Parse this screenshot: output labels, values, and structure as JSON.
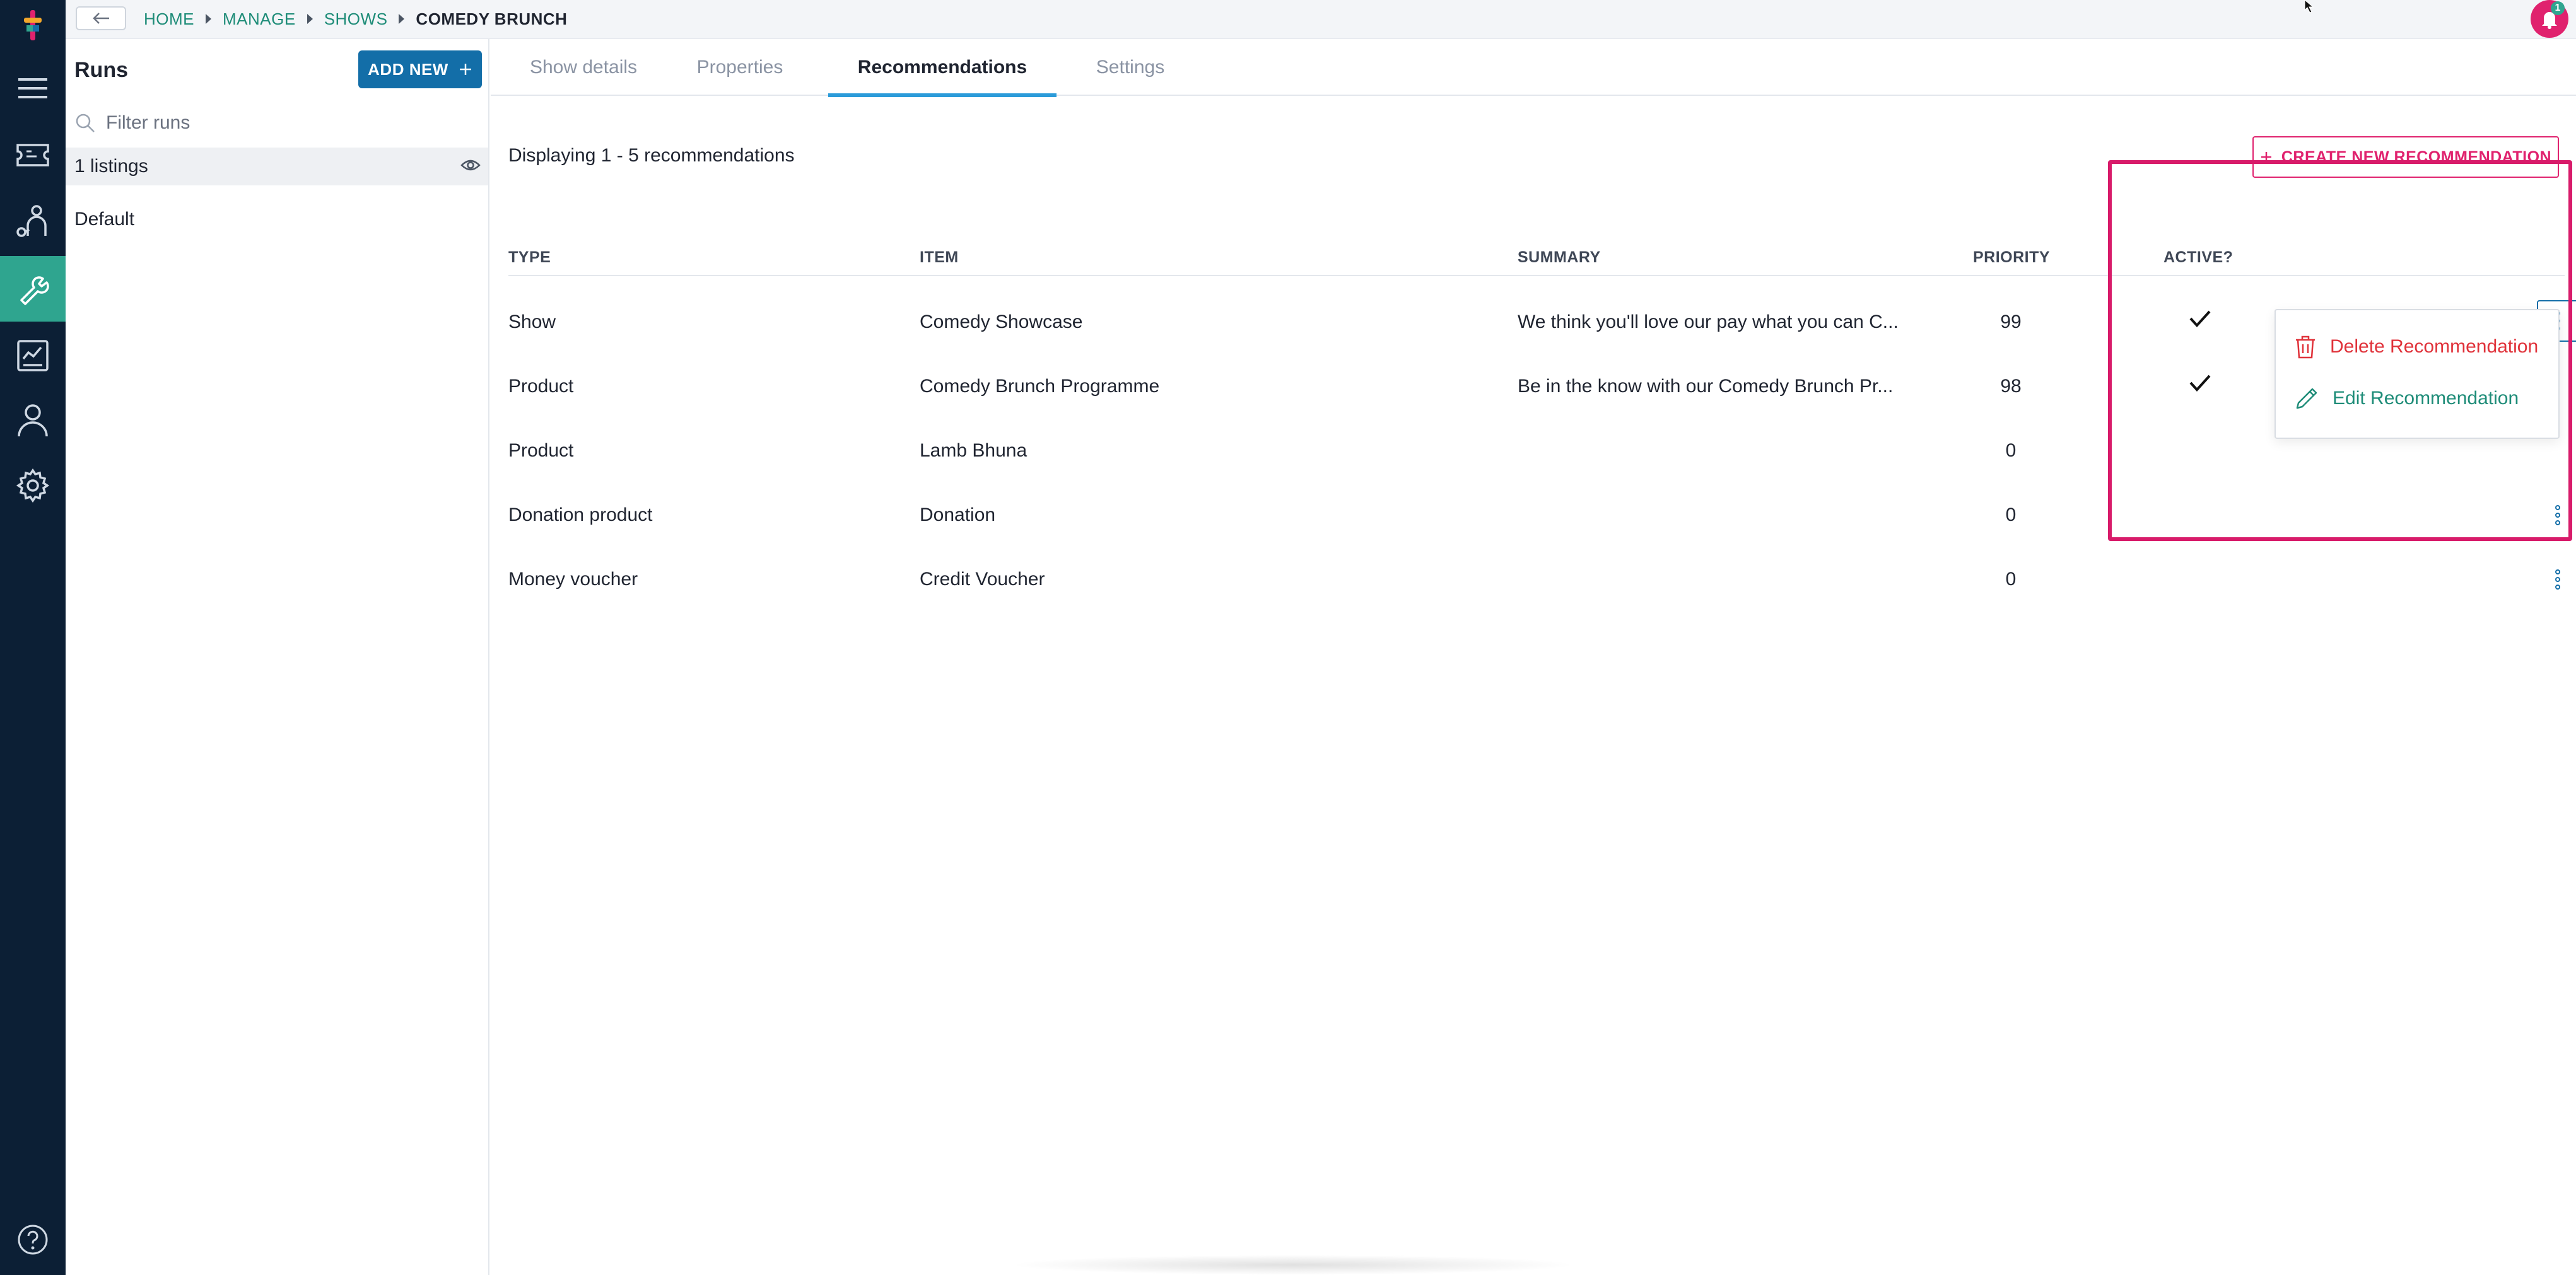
{
  "colors": {
    "rail_bg": "#0c1f35",
    "rail_active": "#2fa58f",
    "primary": "#136ea8",
    "accent_pink": "#e0226e",
    "link_green": "#1e8c78",
    "danger": "#e0323a"
  },
  "rail": {
    "icons": [
      "logo-icon",
      "menu-icon",
      "ticket-icon",
      "user-network-icon",
      "wrench-icon",
      "report-icon",
      "person-icon",
      "gear-icon",
      "help-icon"
    ],
    "active": "wrench-icon"
  },
  "topbar": {
    "breadcrumb": [
      "HOME",
      "MANAGE",
      "SHOWS",
      "COMEDY BRUNCH"
    ],
    "notification_count": "1"
  },
  "runs": {
    "title": "Runs",
    "add_new_label": "ADD NEW",
    "filter_placeholder": "Filter runs",
    "items": [
      "1 listings",
      "Default"
    ]
  },
  "tabs": [
    "Show details",
    "Properties",
    "Recommendations",
    "Settings"
  ],
  "active_tab": "Recommendations",
  "recommendations": {
    "display_text": "Displaying 1 - 5 recommendations",
    "create_label": "CREATE NEW RECOMMENDATION",
    "columns": [
      "TYPE",
      "ITEM",
      "SUMMARY",
      "PRIORITY",
      "ACTIVE?"
    ],
    "rows": [
      {
        "type": "Show",
        "item": "Comedy Showcase",
        "summary": "We think you'll love our pay what you can C...",
        "priority": "99",
        "active": true
      },
      {
        "type": "Product",
        "item": "Comedy Brunch Programme",
        "summary": "Be in the know with our Comedy Brunch Pr...",
        "priority": "98",
        "active": true
      },
      {
        "type": "Product",
        "item": "Lamb Bhuna",
        "summary": "",
        "priority": "0",
        "active": false
      },
      {
        "type": "Donation product",
        "item": "Donation",
        "summary": "",
        "priority": "0",
        "active": false
      },
      {
        "type": "Money voucher",
        "item": "Credit Voucher",
        "summary": "",
        "priority": "0",
        "active": false
      }
    ]
  },
  "dropdown": {
    "delete_label": "Delete Recommendation",
    "edit_label": "Edit Recommendation"
  }
}
